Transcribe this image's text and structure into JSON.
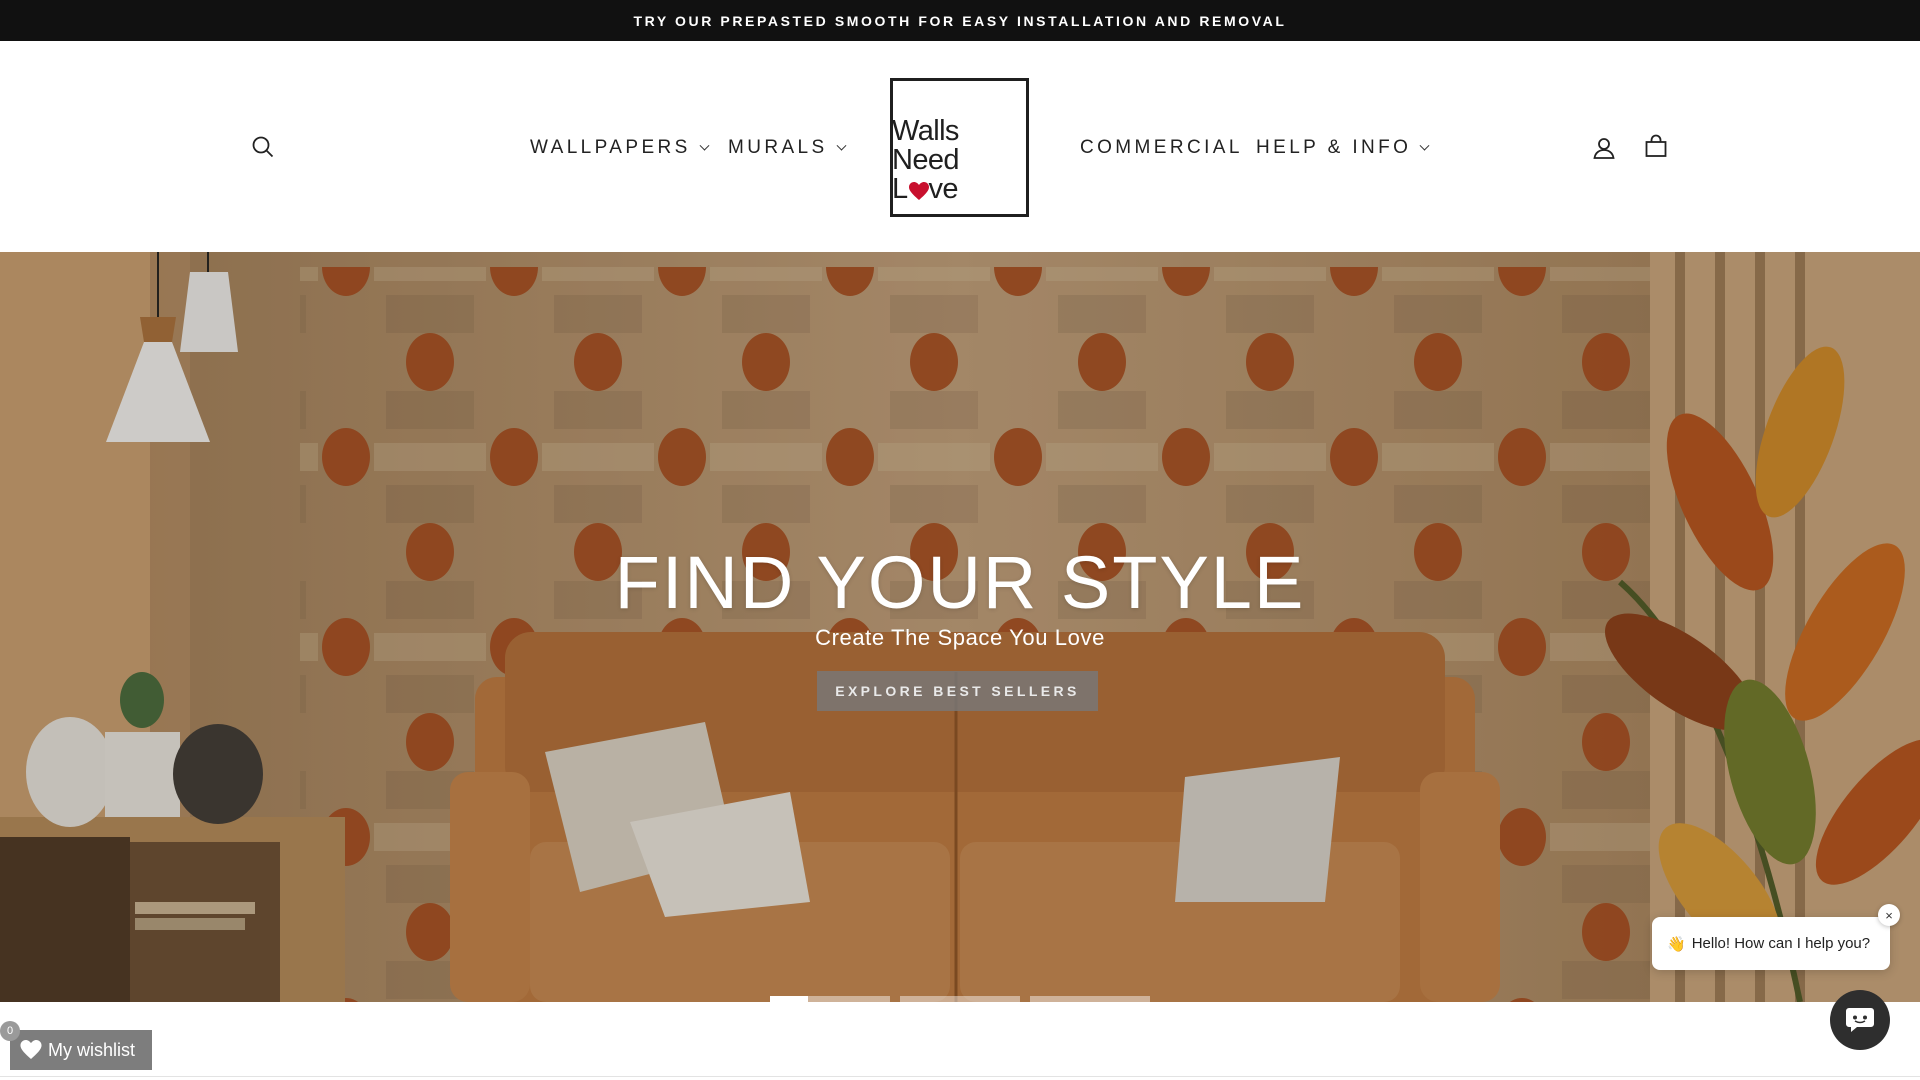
{
  "announcement": {
    "text": "TRY OUR PREPASTED SMOOTH FOR EASY INSTALLATION AND REMOVAL"
  },
  "header": {
    "nav_left": [
      {
        "label": "WALLPAPERS",
        "has_dropdown": true
      },
      {
        "label": "MURALS",
        "has_dropdown": true
      }
    ],
    "nav_right": [
      {
        "label": "COMMERCIAL",
        "has_dropdown": false
      },
      {
        "label": "HELP & INFO",
        "has_dropdown": true
      }
    ],
    "logo": {
      "line1": "Walls",
      "line2": "Need",
      "line3_start": "L",
      "line3_end": "ve",
      "heart_color": "#c8102e"
    },
    "icons": {
      "search": "search-icon",
      "account": "user-icon",
      "cart": "cart-icon"
    }
  },
  "hero": {
    "title": "FIND YOUR STYLE",
    "subtitle": "Create The Space You Love",
    "cta": "EXPLORE BEST SELLERS",
    "slides_count": 3,
    "active_slide": 1,
    "active_slide_progress": 0.32
  },
  "wishlist": {
    "label": "My wishlist",
    "count": "0"
  },
  "chat": {
    "greeting_emoji": "👋",
    "greeting": "Hello! How can I help you?",
    "close": "×"
  },
  "colors": {
    "announcement_bg": "#111111",
    "accent_heart": "#c8102e",
    "dot_orange": "#a64a1e",
    "sofa": "#c07a40"
  }
}
